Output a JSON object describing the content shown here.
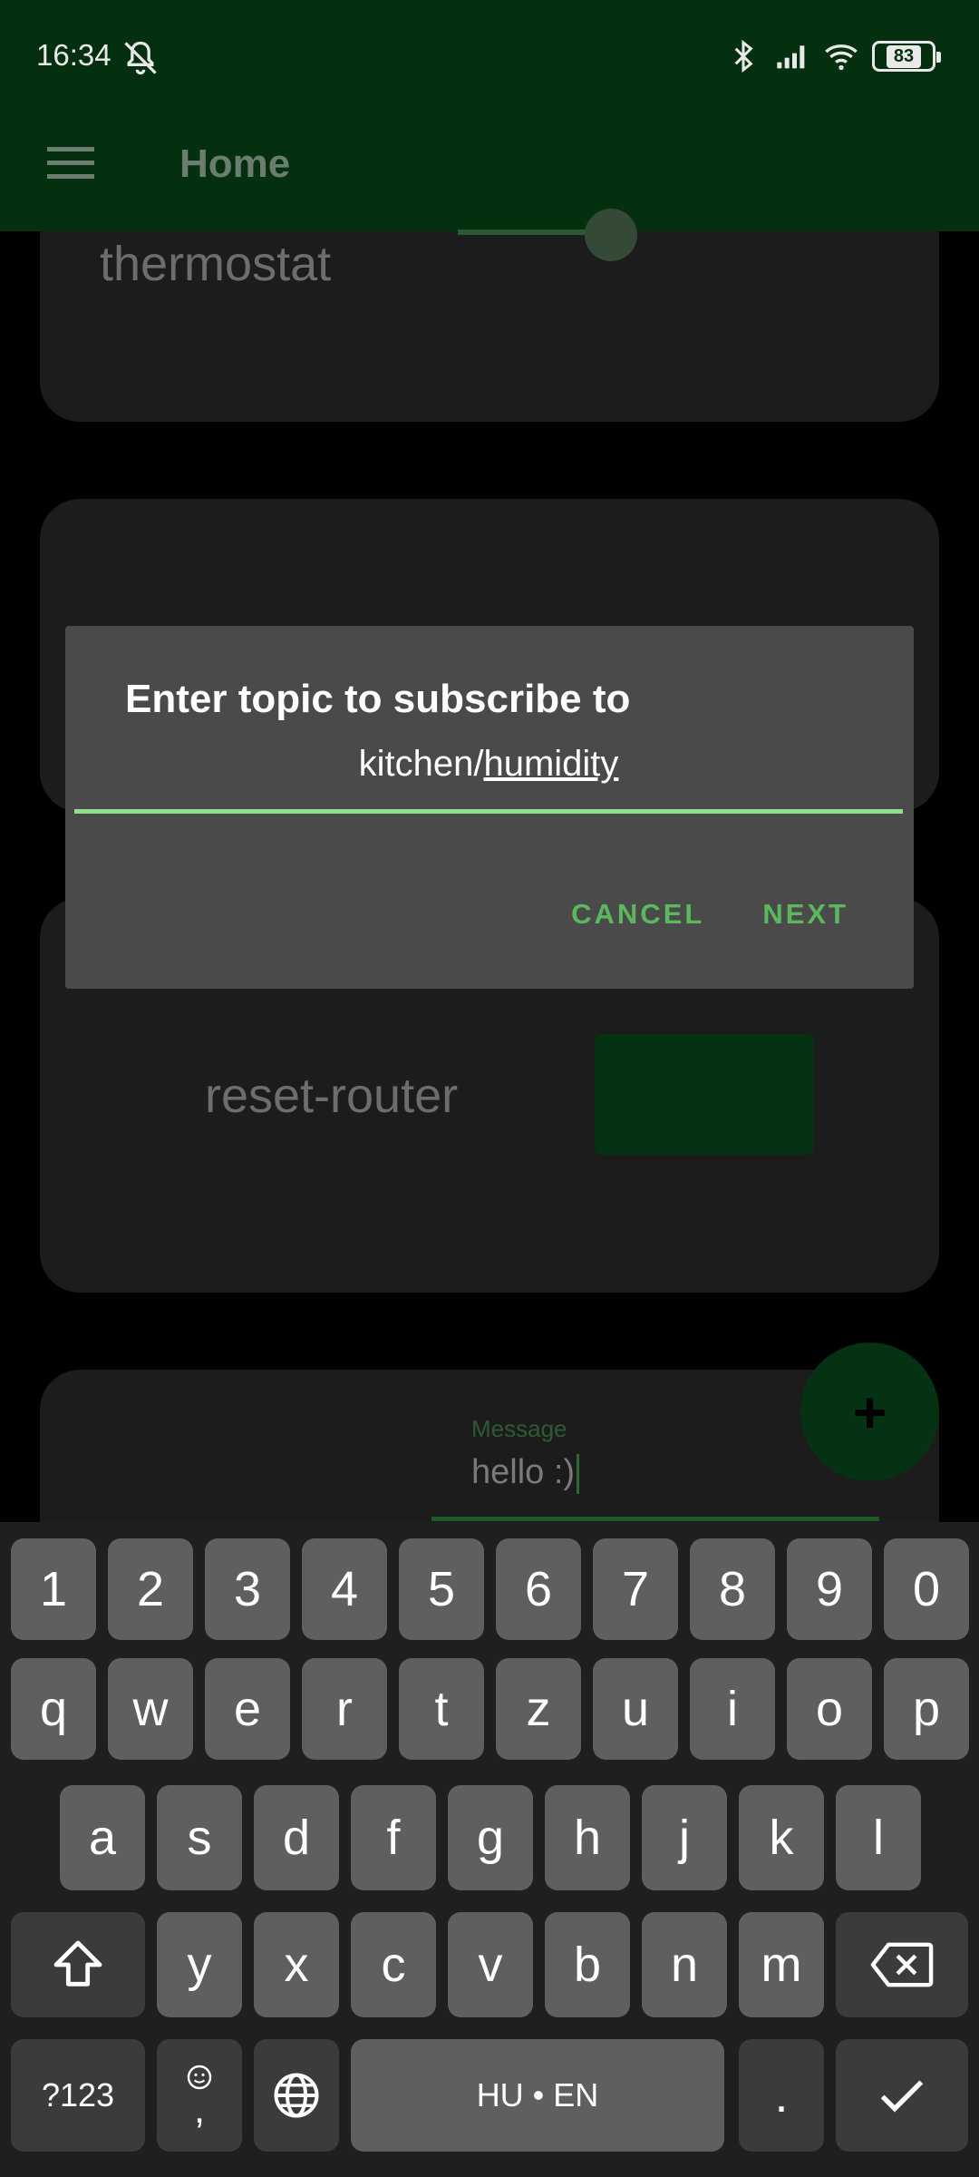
{
  "status": {
    "time": "16:34",
    "battery": "83"
  },
  "appbar": {
    "title": "Home"
  },
  "cards": {
    "thermostat_label": "thermostat",
    "router_label": "reset-router",
    "message_label": "Message",
    "message_value": "hello :)"
  },
  "dialog": {
    "title": "Enter topic to subscribe to",
    "input_prefix": "kitchen/",
    "input_typed": "humidity",
    "cancel_label": "CANCEL",
    "next_label": "NEXT"
  },
  "fab": {
    "icon": "+"
  },
  "keyboard": {
    "row1": [
      "1",
      "2",
      "3",
      "4",
      "5",
      "6",
      "7",
      "8",
      "9",
      "0"
    ],
    "row2": [
      "q",
      "w",
      "e",
      "r",
      "t",
      "z",
      "u",
      "i",
      "o",
      "p"
    ],
    "row3": [
      "a",
      "s",
      "d",
      "f",
      "g",
      "h",
      "j",
      "k",
      "l"
    ],
    "row4": [
      "y",
      "x",
      "c",
      "v",
      "b",
      "n",
      "m"
    ],
    "symbols_label": "?123",
    "emoji_comma": ",",
    "space_label": "HU • EN",
    "period_label": "."
  }
}
